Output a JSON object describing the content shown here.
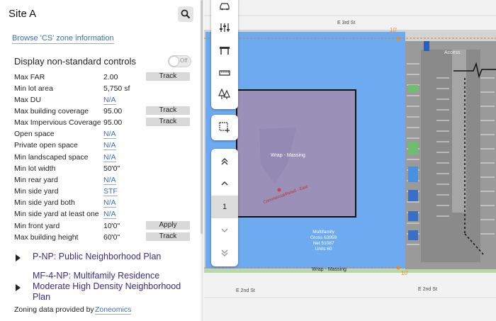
{
  "panel": {
    "site_title": "Site A",
    "browse_link": "Browse 'CS' zone information",
    "display_controls_label": "Display non-standard controls",
    "toggle_text": "Off",
    "rows": [
      {
        "label": "Max FAR",
        "value": "2.00",
        "button": "Track"
      },
      {
        "label": "Min lot area",
        "value": "5,750 sf"
      },
      {
        "label": "Max DU",
        "value": "N/A"
      },
      {
        "label": "Max building coverage",
        "value": "95.00",
        "button": "Track"
      },
      {
        "label": "Max Impervious Coverage",
        "value": "95.00",
        "button": "Track"
      },
      {
        "label": "Open space",
        "value": "N/A"
      },
      {
        "label": "Private open space",
        "value": "N/A"
      },
      {
        "label": "Min landscaped space",
        "value": "N/A"
      },
      {
        "label": "Min lot width",
        "value": "50'0\""
      },
      {
        "label": "Min rear yard",
        "value": "N/A"
      },
      {
        "label": "Min side yard",
        "value": "STF"
      },
      {
        "label": "Min side yard both",
        "value": "N/A"
      },
      {
        "label": "Min side yard at least one",
        "value": "N/A"
      },
      {
        "label": "Min front yard",
        "value": "10'0\"",
        "button": "Apply"
      },
      {
        "label": "Max building height",
        "value": "60'0\"",
        "button": "Track"
      }
    ],
    "plans": [
      {
        "line1": "P-NP: Public Neighborhood Plan"
      },
      {
        "line1": "MF-4-NP: Multifamily Residence",
        "line2": "Moderate High Density Neighborhood",
        "line3": "Plan"
      }
    ],
    "footer_text": "Zoning data provided by",
    "footer_link": "Zoneomics"
  },
  "map": {
    "street_top": "E 3rd St",
    "street_bottom_left": "E 2nd St",
    "street_bottom_right": "E 2nd St",
    "dim_top": "10'",
    "dim_bottom": "10'",
    "wrap_massing": "Wrap - Massing",
    "wrap_massing_bottom": "Wrap - Massing",
    "access_label": "Access",
    "stats": [
      "Multifamily",
      "Gross 63959",
      "Net 51087",
      "Units 60"
    ],
    "commercial_label": "Commercial/Retail - East",
    "colors": {
      "site_blue": "#6eaaf0",
      "massing": "#9a90b8",
      "garage": "#9a9a9a"
    }
  },
  "toolbar": {
    "page_number": "1"
  }
}
